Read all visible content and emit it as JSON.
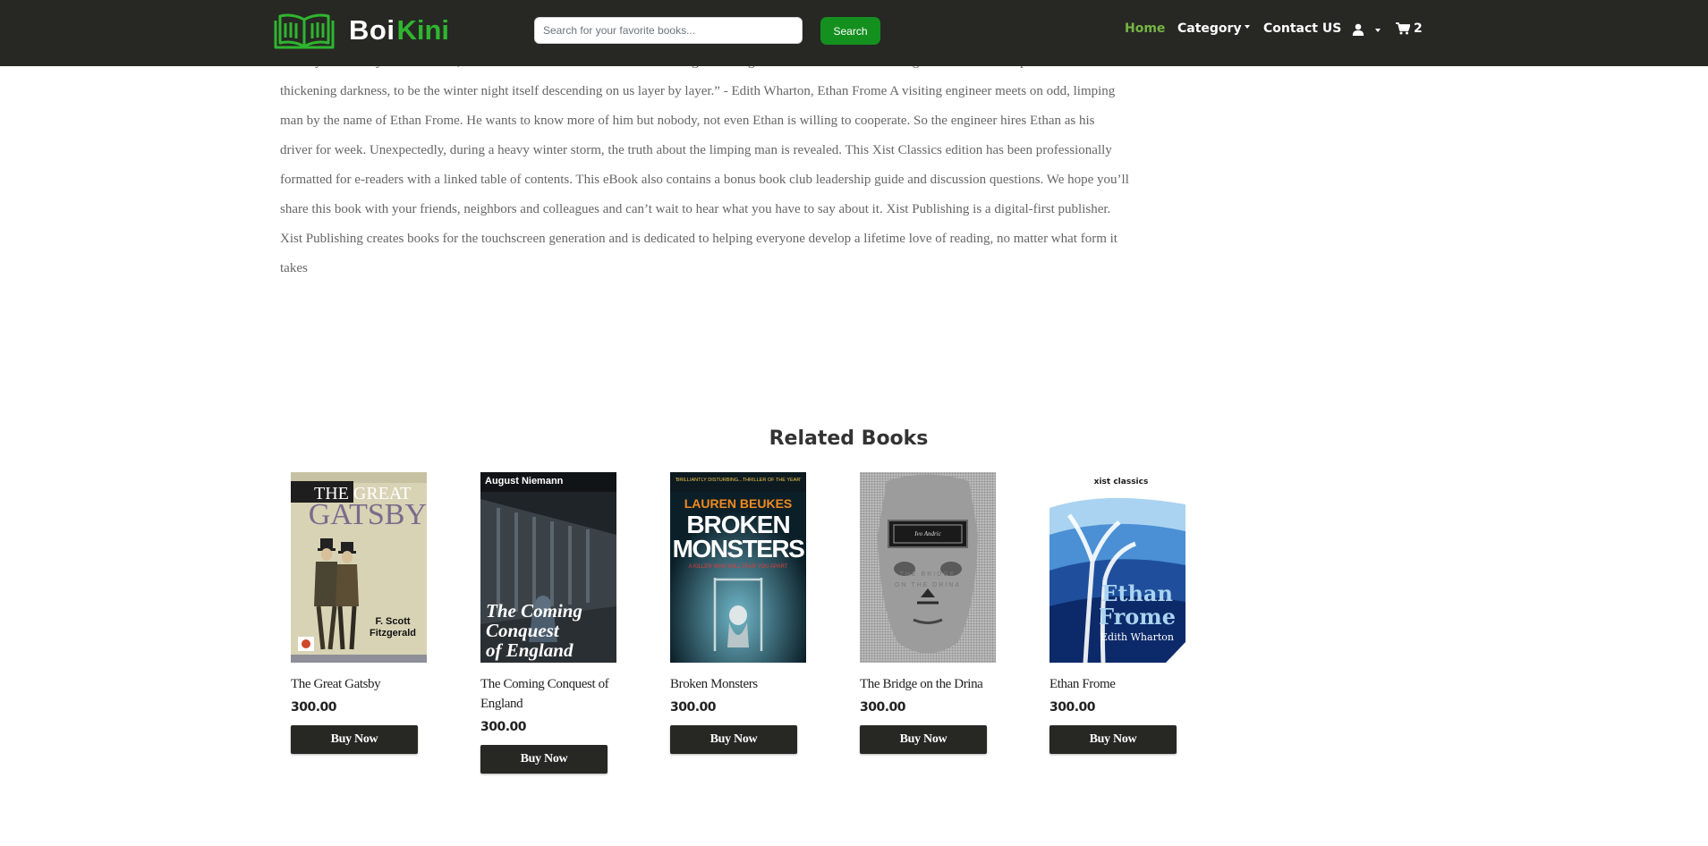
{
  "brand": {
    "name_part1": "Boi",
    "name_part2": "Kini",
    "logo_icon": "open-book-icon"
  },
  "search": {
    "placeholder": "Search for your favorite books...",
    "button_label": "Search"
  },
  "nav": {
    "home": "Home",
    "category": "Category",
    "contact": "Contact US",
    "cart_count": "2"
  },
  "colors": {
    "navbar_bg": "#272824",
    "brand_green": "#2fb52f",
    "search_btn": "#14901e",
    "nav_active": "#75b543"
  },
  "description": {
    "text": "steadily from a sky without wind, in a soft universal diffusion more confusing than the gusts and eddies of the morning. It seemed to be a part of the thickening darkness, to be the winter night itself descending on us layer by layer.” - Edith Wharton, Ethan Frome A visiting engineer meets on odd, limping man by the name of Ethan Frome. He wants to know more of him but nobody, not even Ethan is willing to cooperate. So the engineer hires Ethan as his driver for week. Unexpectedly, during a heavy winter storm, the truth about the limping man is revealed. This Xist Classics edition has been professionally formatted for e-readers with a linked table of contents. This eBook also contains a bonus book club leadership guide and discussion questions. We hope you’ll share this book with your friends, neighbors and colleagues and can’t wait to hear what you have to say about it. Xist Publishing is a digital-first publisher. Xist Publishing creates books for the touchscreen generation and is dedicated to helping everyone develop a lifetime love of reading, no matter what form it takes"
  },
  "related": {
    "title": "Related Books",
    "books": [
      {
        "title": "The Great Gatsby",
        "price": "300.00",
        "button": "Buy Now",
        "cover": {
          "line1": "THE GREAT",
          "line2": "GATSBY",
          "author_l1": "F. Scott",
          "author_l2": "Fitzgerald"
        }
      },
      {
        "title": "The Coming Conquest of England",
        "price": "300.00",
        "button": "Buy Now",
        "cover": {
          "author": "August Niemann",
          "line1": "The Coming",
          "line2": "Conquest",
          "line3": "of England"
        }
      },
      {
        "title": "Broken Monsters",
        "price": "300.00",
        "button": "Buy Now",
        "cover": {
          "blurb": "'BRILLIANTLY DISTURBING...THRILLER OF THE YEAR'",
          "author": "LAUREN BEUKES",
          "line1": "BROKEN",
          "line2": "MONSTERS",
          "tagline": "A KILLER WHO WILL TEAR YOU APART"
        }
      },
      {
        "title": "The Bridge on the Drina",
        "price": "300.00",
        "button": "Buy Now",
        "cover": {
          "author": "Ivo Andric",
          "line1": "THE BRIDGE",
          "line2": "ON THE DRINA"
        }
      },
      {
        "title": "Ethan Frome",
        "price": "300.00",
        "button": "Buy Now",
        "cover": {
          "series": "xist classics",
          "line1": "Ethan",
          "line2": "Frome",
          "author": "Edith Wharton"
        }
      }
    ]
  }
}
